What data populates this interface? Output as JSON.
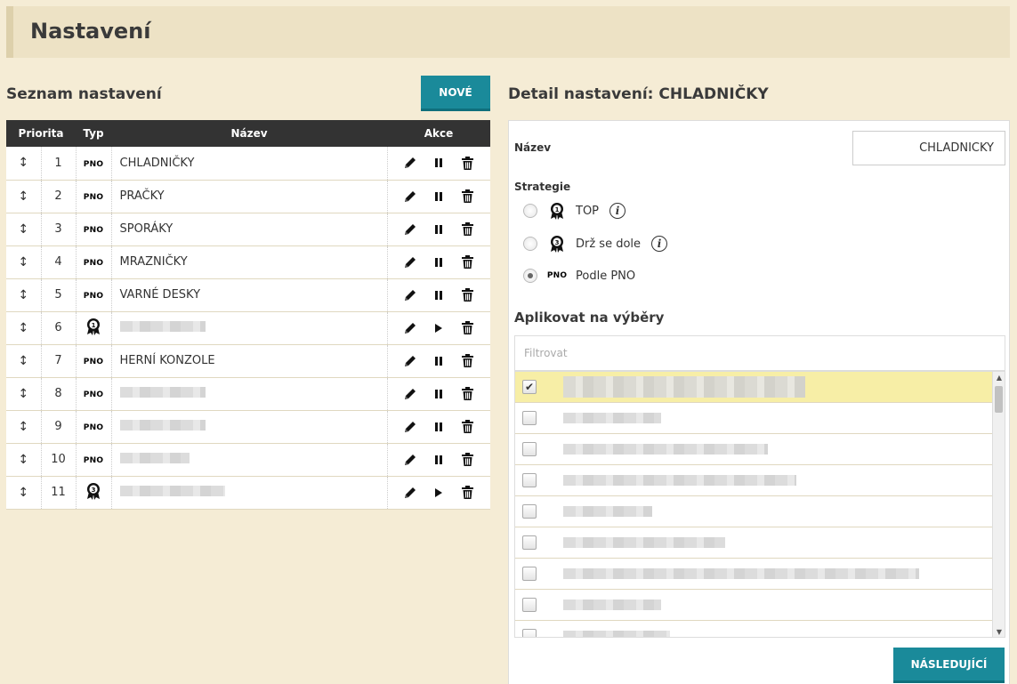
{
  "header": {
    "title": "Nastavení"
  },
  "left": {
    "title": "Seznam nastavení",
    "new_button": "NOVÉ",
    "columns": {
      "priority": "Priorita",
      "type": "Typ",
      "name": "Název",
      "actions": "Akce"
    },
    "rows": [
      {
        "num": "1",
        "type": "pno",
        "type_label": "PNO",
        "name": "CHLADNIČKY",
        "state": "pause"
      },
      {
        "num": "2",
        "type": "pno",
        "type_label": "PNO",
        "name": "PRAČKY",
        "state": "pause"
      },
      {
        "num": "3",
        "type": "pno",
        "type_label": "PNO",
        "name": "SPORÁKY",
        "state": "pause"
      },
      {
        "num": "4",
        "type": "pno",
        "type_label": "PNO",
        "name": "MRAZNIČKY",
        "state": "pause"
      },
      {
        "num": "5",
        "type": "pno",
        "type_label": "PNO",
        "name": "VARNÉ DESKY",
        "state": "pause"
      },
      {
        "num": "6",
        "type": "top",
        "type_label": "",
        "name": "",
        "state": "play"
      },
      {
        "num": "7",
        "type": "pno",
        "type_label": "PNO",
        "name": "HERNÍ KONZOLE",
        "state": "pause"
      },
      {
        "num": "8",
        "type": "pno",
        "type_label": "PNO",
        "name": "",
        "state": "pause"
      },
      {
        "num": "9",
        "type": "pno",
        "type_label": "PNO",
        "name": "",
        "state": "pause"
      },
      {
        "num": "10",
        "type": "pno",
        "type_label": "PNO",
        "name": "",
        "state": "pause"
      },
      {
        "num": "11",
        "type": "bottom",
        "type_label": "",
        "name": "",
        "state": "play"
      }
    ]
  },
  "right": {
    "title": "Detail nastavení: CHLADNIČKY",
    "name_label": "Název",
    "name_value": "CHLADNIČKY",
    "strategy_label": "Strategie",
    "strategies": [
      {
        "label": "TOP",
        "badge": "1",
        "checked": false
      },
      {
        "label": "Drž se dole",
        "badge": "3",
        "checked": false
      },
      {
        "label": "Podle PNO",
        "badge": "PNO",
        "checked": true
      }
    ],
    "apply_label": "Aplikovat na výběry",
    "filter_placeholder": "Filtrovat",
    "next_button": "NÁSLEDUJÍCÍ"
  },
  "colors": {
    "accent": "#1a8a9a",
    "background": "#f5ecd5",
    "header_bg": "#ede2c5",
    "selected_row": "#f7eea6"
  }
}
